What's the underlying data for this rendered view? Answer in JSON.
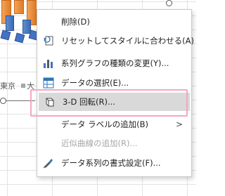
{
  "background": {
    "axis_label_tokyo": "東京",
    "axis_label_fragment": "大"
  },
  "menu": {
    "items": [
      {
        "label": "削除(D)",
        "icon": "none",
        "disabled": false
      },
      {
        "label": "リセットしてスタイルに合わせる(A)",
        "icon": "reset-style-icon",
        "disabled": false
      },
      {
        "label": "系列グラフの種類の変更(Y)...",
        "icon": "change-chart-type-icon",
        "disabled": false
      },
      {
        "label": "データの選択(E)...",
        "icon": "select-data-icon",
        "disabled": false
      },
      {
        "label": "3-D 回転(R)...",
        "icon": "3d-rotation-icon",
        "disabled": false,
        "highlighted": true
      },
      {
        "label": "データ ラベルの追加(B)",
        "icon": "none",
        "disabled": false,
        "has_submenu": true
      },
      {
        "label": "近似曲線の追加(R)...",
        "icon": "none",
        "disabled": true
      },
      {
        "label": "データ系列の書式設定(F)...",
        "icon": "format-series-icon",
        "disabled": false
      }
    ],
    "submenu_arrow": ">"
  },
  "colors": {
    "highlight_border": "#f4a7c3",
    "hover_bg": "#d9d9d9",
    "bar_orange": "#ed7d31",
    "bar_blue": "#4472c4"
  }
}
